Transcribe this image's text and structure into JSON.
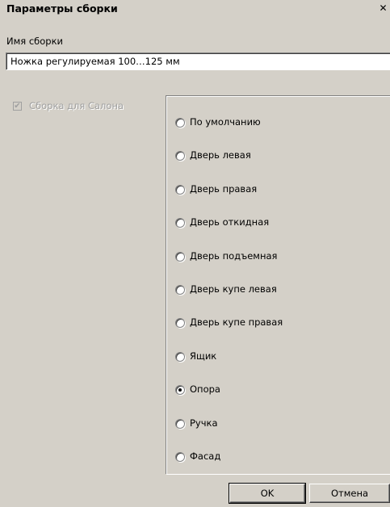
{
  "window": {
    "title": "Параметры сборки",
    "close_label": "✕"
  },
  "assembly_name": {
    "label": "Имя сборки",
    "value": "Ножка регулируемая 100…125 мм"
  },
  "salon_checkbox": {
    "label": "Сборка для Салона",
    "checked": true,
    "enabled": false
  },
  "door_type": {
    "options": [
      {
        "label": "По умолчанию",
        "selected": false
      },
      {
        "label": "Дверь левая",
        "selected": false
      },
      {
        "label": "Дверь правая",
        "selected": false
      },
      {
        "label": "Дверь откидная",
        "selected": false
      },
      {
        "label": "Дверь подъемная",
        "selected": false
      },
      {
        "label": "Дверь купе левая",
        "selected": false
      },
      {
        "label": "Дверь купе правая",
        "selected": false
      },
      {
        "label": "Ящик",
        "selected": false
      },
      {
        "label": "Опора",
        "selected": true
      },
      {
        "label": "Ручка",
        "selected": false
      },
      {
        "label": "Фасад",
        "selected": false
      }
    ]
  },
  "buttons": {
    "ok_label": "OK",
    "cancel_label": "Отмена"
  }
}
